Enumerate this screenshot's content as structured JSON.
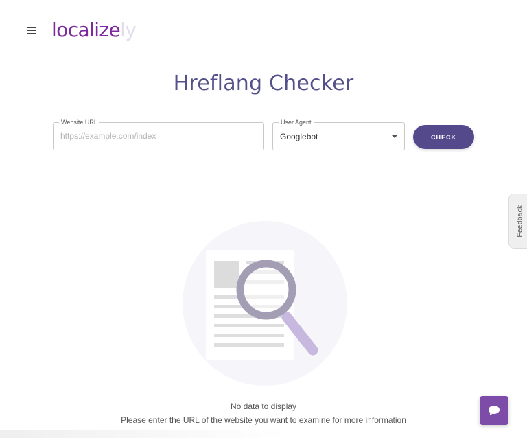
{
  "header": {
    "logo_main": "localize",
    "logo_faded": "ly"
  },
  "page": {
    "title": "Hreflang Checker"
  },
  "form": {
    "url_label": "Website URL",
    "url_placeholder": "https://example.com/index",
    "url_value": "",
    "agent_label": "User Agent",
    "agent_value": "Googlebot",
    "check_label": "CHECK"
  },
  "feedback": {
    "label": "Feedback"
  },
  "empty_state": {
    "title": "No data to display",
    "description": "Please enter the URL of the website you want to examine for more information"
  },
  "colors": {
    "brand": "#7b2a9e",
    "title": "#54508a",
    "button": "#544a8b",
    "chat": "#7d4ba8"
  },
  "icons": {
    "menu": "menu-icon",
    "caret": "chevron-down-icon",
    "illustration": "magnifier-document-icon",
    "chat": "chat-bubble-icon"
  }
}
